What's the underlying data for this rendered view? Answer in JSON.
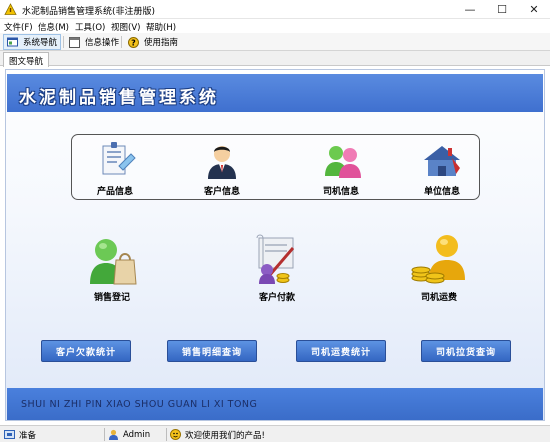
{
  "window": {
    "title": "水泥制品销售管理系统(非注册版)",
    "min_glyph": "—",
    "max_glyph": "☐",
    "close_glyph": "✕"
  },
  "menu": {
    "items": [
      {
        "label": "文件(F)"
      },
      {
        "label": "信息(M)"
      },
      {
        "label": "工具(O)"
      },
      {
        "label": "视图(V)"
      },
      {
        "label": "帮助(H)"
      }
    ]
  },
  "toolbar": {
    "nav_label": "系统导航",
    "info_ops_label": "信息操作",
    "guide_label": "使用指南"
  },
  "tabs": {
    "active_label": "图文导航"
  },
  "banner": {
    "title": "水泥制品销售管理系统"
  },
  "info_panel": {
    "items": [
      {
        "label": "产品信息",
        "icon": "product-info-icon"
      },
      {
        "label": "客户信息",
        "icon": "customer-info-icon"
      },
      {
        "label": "司机信息",
        "icon": "driver-info-icon"
      },
      {
        "label": "单位信息",
        "icon": "unit-info-icon"
      }
    ]
  },
  "features": {
    "items": [
      {
        "label": "销售登记",
        "icon": "sales-register-icon"
      },
      {
        "label": "客户付款",
        "icon": "customer-payment-icon"
      },
      {
        "label": "司机运费",
        "icon": "driver-freight-icon"
      }
    ]
  },
  "query_buttons": {
    "items": [
      {
        "label": "客户欠款统计"
      },
      {
        "label": "销售明细查询"
      },
      {
        "label": "司机运费统计"
      },
      {
        "label": "司机拉货查询"
      }
    ]
  },
  "footer": {
    "pinyin": "SHUI NI ZHI PIN XIAO SHOU GUAN LI XI TONG"
  },
  "status": {
    "ready": "准备",
    "user": "Admin",
    "welcome": "欢迎使用我们的产品!"
  },
  "colors": {
    "banner_blue": "#4a7dda",
    "button_blue": "#3d72cc",
    "footer_text": "#1b2e66"
  }
}
